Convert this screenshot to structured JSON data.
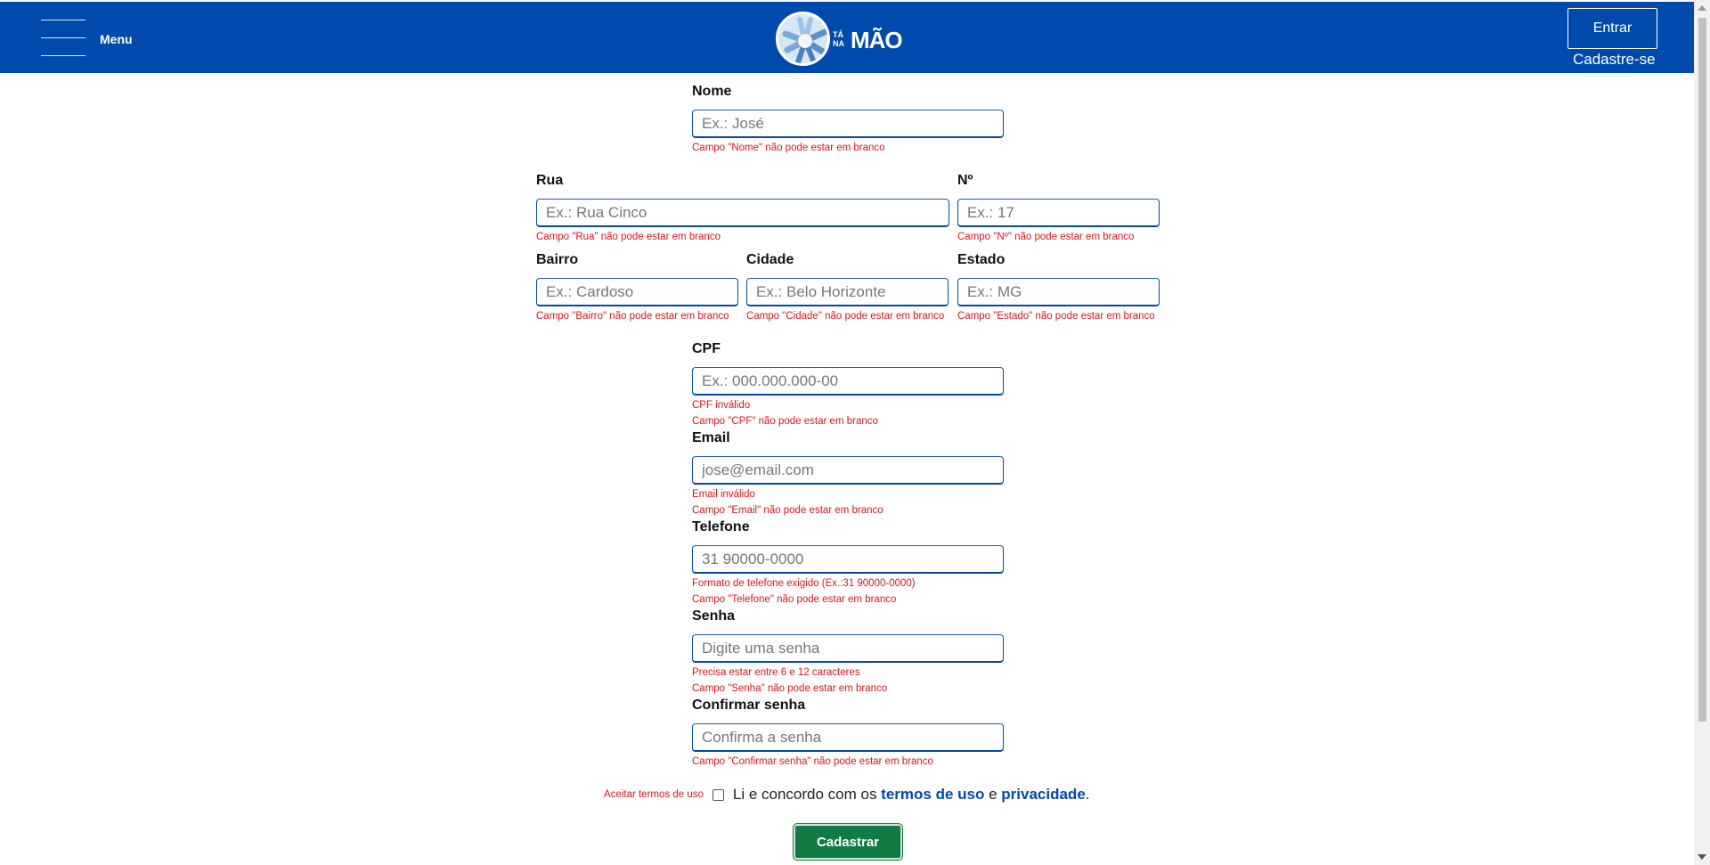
{
  "header": {
    "menu_label": "Menu",
    "logo_small": "TÁ NA",
    "logo_big": "MÃO",
    "login_label": "Entrar",
    "signup_label": "Cadastre-se",
    "background": "#004aad"
  },
  "form": {
    "nome": {
      "label": "Nome",
      "placeholder": "Ex.: José",
      "errors": [
        "Campo \"Nome\" não pode estar em branco"
      ]
    },
    "rua": {
      "label": "Rua",
      "placeholder": "Ex.: Rua Cinco",
      "errors": [
        "Campo \"Rua\" não pode estar em branco"
      ]
    },
    "numero": {
      "label": "Nº",
      "placeholder": "Ex.: 17",
      "errors": [
        "Campo \"Nº\" não pode estar em branco"
      ]
    },
    "bairro": {
      "label": "Bairro",
      "placeholder": "Ex.: Cardoso",
      "errors": [
        "Campo \"Bairro\" não pode estar em branco"
      ]
    },
    "cidade": {
      "label": "Cidade",
      "placeholder": "Ex.: Belo Horizonte",
      "errors": [
        "Campo \"Cidade\" não pode estar em branco"
      ]
    },
    "estado": {
      "label": "Estado",
      "placeholder": "Ex.: MG",
      "errors": [
        "Campo \"Estado\" não pode estar em branco"
      ]
    },
    "cpf": {
      "label": "CPF",
      "placeholder": "Ex.: 000.000.000-00",
      "errors": [
        "CPF inválido",
        "Campo \"CPF\" não pode estar em branco"
      ]
    },
    "email": {
      "label": "Email",
      "placeholder": "jose@email.com",
      "errors": [
        "Email inválido",
        "Campo \"Email\" não pode estar em branco"
      ]
    },
    "telefone": {
      "label": "Telefone",
      "placeholder": "31 90000-0000",
      "errors": [
        "Formato de telefone exigido (Ex.:31 90000-0000)",
        "Campo \"Telefone\" não pode estar em branco"
      ]
    },
    "senha": {
      "label": "Senha",
      "placeholder": "Digite uma senha",
      "errors": [
        "Precisa estar entre 6 e 12 caracteres",
        "Campo \"Senha\" não pode estar em branco"
      ]
    },
    "confirmar": {
      "label": "Confirmar senha",
      "placeholder": "Confirma a senha",
      "errors": [
        "Campo \"Confirmar senha\" não pode estar em branco"
      ]
    }
  },
  "terms": {
    "error": "Aceitar termos de uso",
    "text_before": "Li e concordo com os ",
    "link_terms": "termos de uso",
    "text_middle": " e ",
    "link_privacy": "privacidade",
    "text_after": ".",
    "checked": false
  },
  "submit_label": "Cadastrar",
  "colors": {
    "primary": "#004aad",
    "error": "#e0131a",
    "submit": "#127a45"
  }
}
